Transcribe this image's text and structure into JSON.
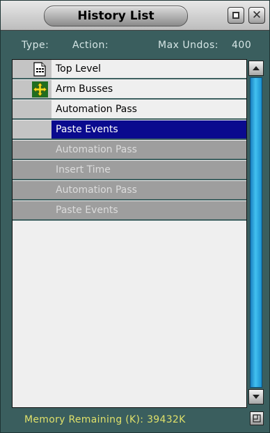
{
  "window": {
    "title": "History List"
  },
  "header": {
    "type_label": "Type:",
    "action_label": "Action:",
    "max_undos_label": "Max Undos:",
    "max_undos_value": "400"
  },
  "history": {
    "rows": [
      {
        "label": "Top Level",
        "icon": "document-icon",
        "state": "done"
      },
      {
        "label": "Arm Busses",
        "icon": "arm-busses-icon",
        "state": "done"
      },
      {
        "label": "Automation Pass",
        "icon": "",
        "state": "done"
      },
      {
        "label": "Paste Events",
        "icon": "",
        "state": "selected"
      },
      {
        "label": "Automation Pass",
        "icon": "",
        "state": "undone"
      },
      {
        "label": "Insert Time",
        "icon": "",
        "state": "undone"
      },
      {
        "label": "Automation Pass",
        "icon": "",
        "state": "undone"
      },
      {
        "label": "Paste Events",
        "icon": "",
        "state": "undone"
      }
    ]
  },
  "status": {
    "memory_label": "Memory Remaining (K):",
    "memory_value": "39432K"
  },
  "colors": {
    "window_bg": "#3a5e5e",
    "selected_bg": "#0a0a8e",
    "undone_bg": "#9e9e9e",
    "scroll_track": "#2aa8e6",
    "status_text": "#dfe06a"
  }
}
